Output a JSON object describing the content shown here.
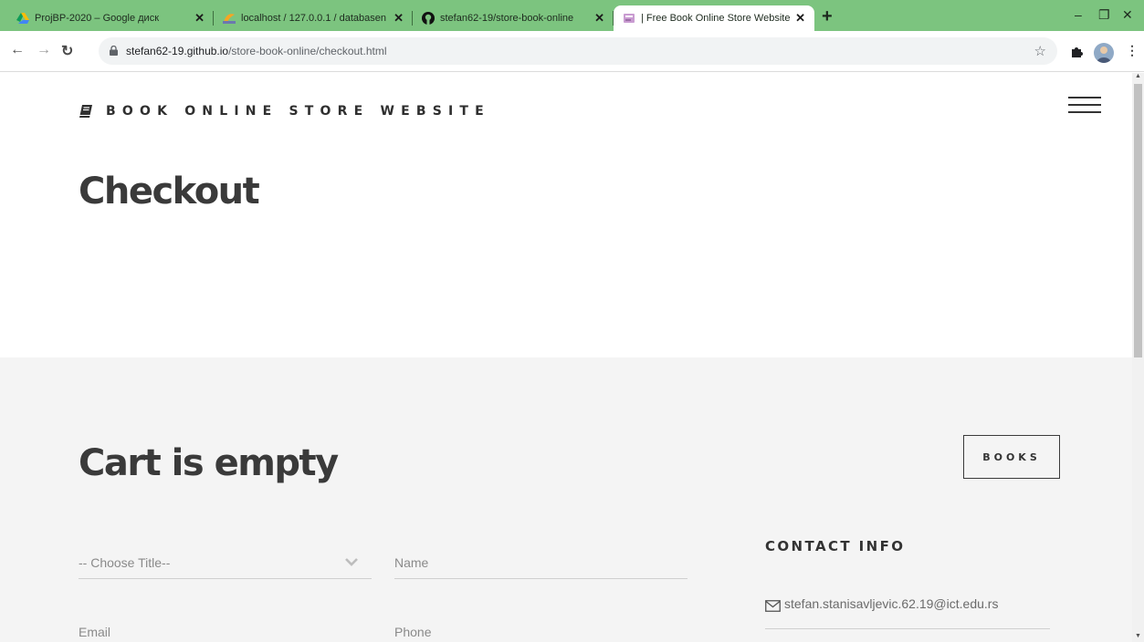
{
  "browser": {
    "tabs": [
      {
        "title": "ProjBP-2020 – Google диск"
      },
      {
        "title": "localhost / 127.0.0.1 / databasen"
      },
      {
        "title": "stefan62-19/store-book-online"
      },
      {
        "title": "| Free Book Online Store Website"
      }
    ],
    "url_host": "stefan62-19.github.io",
    "url_path": "/store-book-online/checkout.html"
  },
  "header": {
    "brand": "BOOK ONLINE STORE WEBSITE"
  },
  "page_title": "Checkout",
  "cart": {
    "status": "Cart is empty",
    "books_button": "BOOKS"
  },
  "form": {
    "title_select": "-- Choose Title--",
    "name_placeholder": "Name",
    "email_placeholder": "Email",
    "phone_placeholder": "Phone"
  },
  "contact": {
    "heading": "CONTACT INFO",
    "email": "stefan.stanisavljevic.62.19@ict.edu.rs"
  },
  "colors": {
    "tabbar": "#7cc47f",
    "section_bg": "#f4f4f4",
    "heading_text": "#3a3a3a"
  }
}
